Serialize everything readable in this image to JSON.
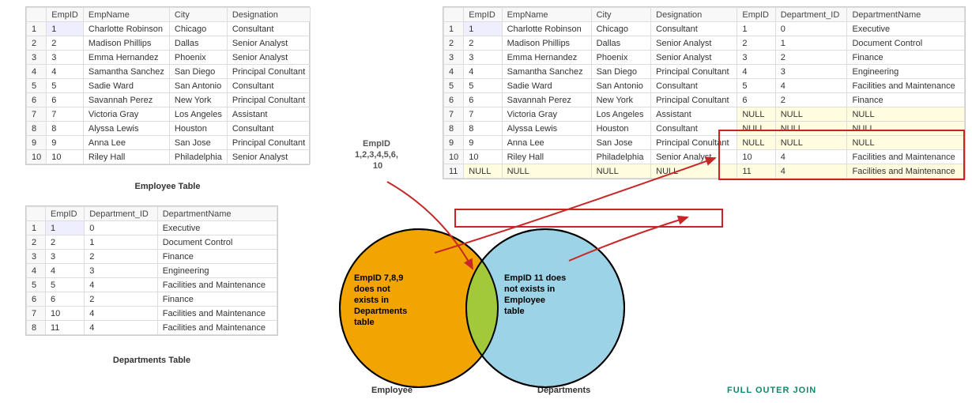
{
  "employee_table": {
    "caption": "Employee Table",
    "headers": [
      "",
      "EmpID",
      "EmpName",
      "City",
      "Designation"
    ],
    "rows": [
      [
        "1",
        "1",
        "Charlotte Robinson",
        "Chicago",
        "Consultant"
      ],
      [
        "2",
        "2",
        "Madison Phillips",
        "Dallas",
        "Senior Analyst"
      ],
      [
        "3",
        "3",
        "Emma Hernandez",
        "Phoenix",
        "Senior Analyst"
      ],
      [
        "4",
        "4",
        "Samantha Sanchez",
        "San Diego",
        "Principal Conultant"
      ],
      [
        "5",
        "5",
        "Sadie Ward",
        "San Antonio",
        "Consultant"
      ],
      [
        "6",
        "6",
        "Savannah Perez",
        "New York",
        "Principal Conultant"
      ],
      [
        "7",
        "7",
        "Victoria Gray",
        "Los Angeles",
        "Assistant"
      ],
      [
        "8",
        "8",
        "Alyssa Lewis",
        "Houston",
        "Consultant"
      ],
      [
        "9",
        "9",
        "Anna Lee",
        "San Jose",
        "Principal Conultant"
      ],
      [
        "10",
        "10",
        "Riley Hall",
        "Philadelphia",
        "Senior Analyst"
      ]
    ]
  },
  "departments_table": {
    "caption": "Departments Table",
    "headers": [
      "",
      "EmpID",
      "Department_ID",
      "DepartmentName"
    ],
    "rows": [
      [
        "1",
        "1",
        "0",
        "Executive"
      ],
      [
        "2",
        "2",
        "1",
        "Document Control"
      ],
      [
        "3",
        "3",
        "2",
        "Finance"
      ],
      [
        "4",
        "4",
        "3",
        "Engineering"
      ],
      [
        "5",
        "5",
        "4",
        "Facilities and Maintenance"
      ],
      [
        "6",
        "6",
        "2",
        "Finance"
      ],
      [
        "7",
        "10",
        "4",
        "Facilities and Maintenance"
      ],
      [
        "8",
        "11",
        "4",
        "Facilities and Maintenance"
      ]
    ]
  },
  "join_table": {
    "headers": [
      "",
      "EmpID",
      "EmpName",
      "City",
      "Designation",
      "EmpID",
      "Department_ID",
      "DepartmentName"
    ],
    "rows": [
      {
        "n": "1",
        "cells": [
          "1",
          "Charlotte Robinson",
          "Chicago",
          "Consultant",
          "1",
          "0",
          "Executive"
        ],
        "null_right": false,
        "null_left": false
      },
      {
        "n": "2",
        "cells": [
          "2",
          "Madison Phillips",
          "Dallas",
          "Senior Analyst",
          "2",
          "1",
          "Document Control"
        ],
        "null_right": false,
        "null_left": false
      },
      {
        "n": "3",
        "cells": [
          "3",
          "Emma Hernandez",
          "Phoenix",
          "Senior Analyst",
          "3",
          "2",
          "Finance"
        ],
        "null_right": false,
        "null_left": false
      },
      {
        "n": "4",
        "cells": [
          "4",
          "Samantha Sanchez",
          "San Diego",
          "Principal Conultant",
          "4",
          "3",
          "Engineering"
        ],
        "null_right": false,
        "null_left": false
      },
      {
        "n": "5",
        "cells": [
          "5",
          "Sadie Ward",
          "San Antonio",
          "Consultant",
          "5",
          "4",
          "Facilities and Maintenance"
        ],
        "null_right": false,
        "null_left": false
      },
      {
        "n": "6",
        "cells": [
          "6",
          "Savannah Perez",
          "New York",
          "Principal Conultant",
          "6",
          "2",
          "Finance"
        ],
        "null_right": false,
        "null_left": false
      },
      {
        "n": "7",
        "cells": [
          "7",
          "Victoria Gray",
          "Los Angeles",
          "Assistant",
          "NULL",
          "NULL",
          "NULL"
        ],
        "null_right": true,
        "null_left": false
      },
      {
        "n": "8",
        "cells": [
          "8",
          "Alyssa Lewis",
          "Houston",
          "Consultant",
          "NULL",
          "NULL",
          "NULL"
        ],
        "null_right": true,
        "null_left": false
      },
      {
        "n": "9",
        "cells": [
          "9",
          "Anna Lee",
          "San Jose",
          "Principal Conultant",
          "NULL",
          "NULL",
          "NULL"
        ],
        "null_right": true,
        "null_left": false
      },
      {
        "n": "10",
        "cells": [
          "10",
          "Riley Hall",
          "Philadelphia",
          "Senior Analyst",
          "10",
          "4",
          "Facilities and Maintenance"
        ],
        "null_right": false,
        "null_left": false
      },
      {
        "n": "11",
        "cells": [
          "NULL",
          "NULL",
          "NULL",
          "NULL",
          "11",
          "4",
          "Facilities and Maintenance"
        ],
        "null_right": false,
        "null_left": true
      }
    ]
  },
  "venn": {
    "left_label": "Employee",
    "right_label": "Departments",
    "left_text": "EmpID 7,8,9 does not exists in Departments table",
    "right_text": "EmpID 11 does not exists in Employee table",
    "top_label": "EmpID 1,2,3,4,5,6, 10"
  },
  "join_type": "FULL OUTER JOIN"
}
